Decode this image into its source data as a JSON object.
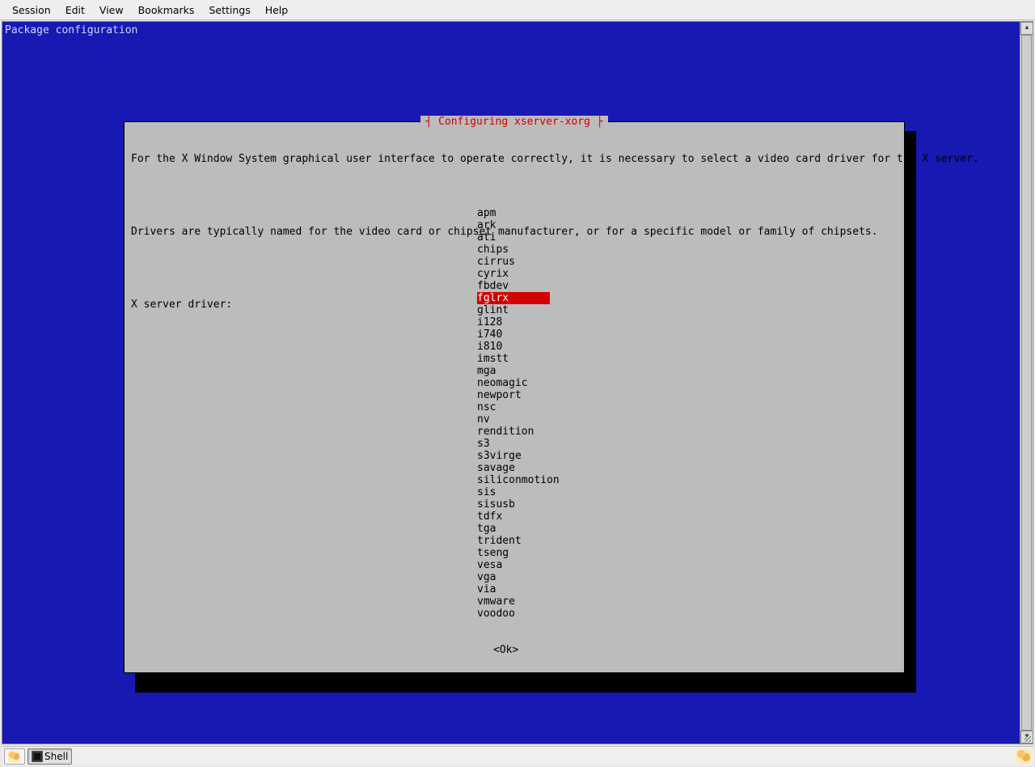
{
  "menubar": {
    "items": [
      "Session",
      "Edit",
      "View",
      "Bookmarks",
      "Settings",
      "Help"
    ]
  },
  "terminal": {
    "title": "Package configuration"
  },
  "dialog": {
    "title": "Configuring xserver-xorg",
    "paragraph1": "For the X Window System graphical user interface to operate correctly, it is necessary to select a video card driver for the X server.",
    "paragraph2": "Drivers are typically named for the video card or chipset manufacturer, or for a specific model or family of chipsets.",
    "prompt": "X server driver:",
    "ok_label": "<Ok>",
    "selected_index": 7,
    "drivers": [
      "apm",
      "ark",
      "ati",
      "chips",
      "cirrus",
      "cyrix",
      "fbdev",
      "fglrx",
      "glint",
      "i128",
      "i740",
      "i810",
      "imstt",
      "mga",
      "neomagic",
      "newport",
      "nsc",
      "nv",
      "rendition",
      "s3",
      "s3virge",
      "savage",
      "siliconmotion",
      "sis",
      "sisusb",
      "tdfx",
      "tga",
      "trident",
      "tseng",
      "vesa",
      "vga",
      "via",
      "vmware",
      "voodoo"
    ]
  },
  "taskbar": {
    "shell_label": "Shell"
  }
}
